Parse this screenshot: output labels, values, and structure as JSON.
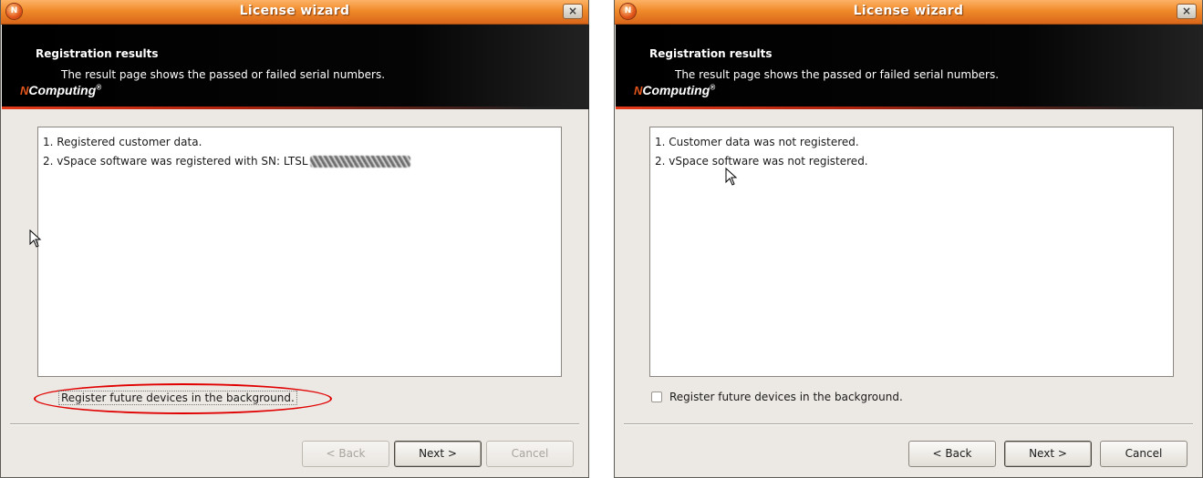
{
  "windows": [
    {
      "title": "License wizard",
      "icon": "app-icon",
      "close_label": "×",
      "banner": {
        "title": "Registration results",
        "subtitle": "The result page shows the passed or failed serial numbers.",
        "logo_mark": "N",
        "logo_text": "Computing",
        "logo_reg": "®"
      },
      "results": [
        "1. Registered customer data.",
        "2. vSpace software was registered with SN: LTSL"
      ],
      "checkbox_label": "Register future devices in the background.",
      "buttons": {
        "back": "< Back",
        "next": "Next >",
        "cancel": "Cancel"
      },
      "back_enabled": false,
      "cancel_enabled": false,
      "annotation_color": "#e00000"
    },
    {
      "title": "License wizard",
      "icon": "app-icon",
      "close_label": "×",
      "banner": {
        "title": "Registration results",
        "subtitle": "The result page shows the passed or failed serial numbers.",
        "logo_mark": "N",
        "logo_text": "Computing",
        "logo_reg": "®"
      },
      "results": [
        "1. Customer data was not registered.",
        "2. vSpace software was not registered."
      ],
      "checkbox_label": "Register future devices in the background.",
      "buttons": {
        "back": "< Back",
        "next": "Next >",
        "cancel": "Cancel"
      },
      "back_enabled": true,
      "cancel_enabled": true
    }
  ],
  "colors": {
    "titlebar": "#f08a2a",
    "banner": "#000000",
    "accent": "#e2551a",
    "window_bg": "#ece9e4"
  }
}
